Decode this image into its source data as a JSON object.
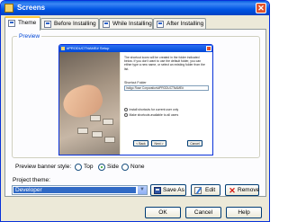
{
  "window": {
    "title": "Screens"
  },
  "tabs": [
    {
      "label": "Theme"
    },
    {
      "label": "Before Installing"
    },
    {
      "label": "While Installing"
    },
    {
      "label": "After Installing"
    }
  ],
  "preview": {
    "group_label": "Preview",
    "dialog_title": "#PRODUCTNAME# Setup",
    "description": "The shortcut icons will be created in the folder indicated below. If you don't want to use the default folder, you can either type a new name, or select an existing folder from the list.",
    "folder_label": "Shortcut Folder",
    "folder_value": "Indigo Rose Corporation\\#PRODUCTNAME#",
    "radio_current_user": "Install shortcuts for current user only",
    "radio_all_users": "Make shortcuts available to all users",
    "back": "< Back",
    "next": "Next >",
    "cancel": "Cancel"
  },
  "banner_style": {
    "label": "Preview banner style:",
    "options": [
      "Top",
      "Side",
      "None"
    ],
    "selected": "Side"
  },
  "project_theme": {
    "label": "Project theme:",
    "value": "Developer"
  },
  "buttons": {
    "save_as": "Save As",
    "edit": "Edit",
    "remove": "Remove",
    "ok": "OK",
    "cancel": "Cancel",
    "help": "Help"
  }
}
